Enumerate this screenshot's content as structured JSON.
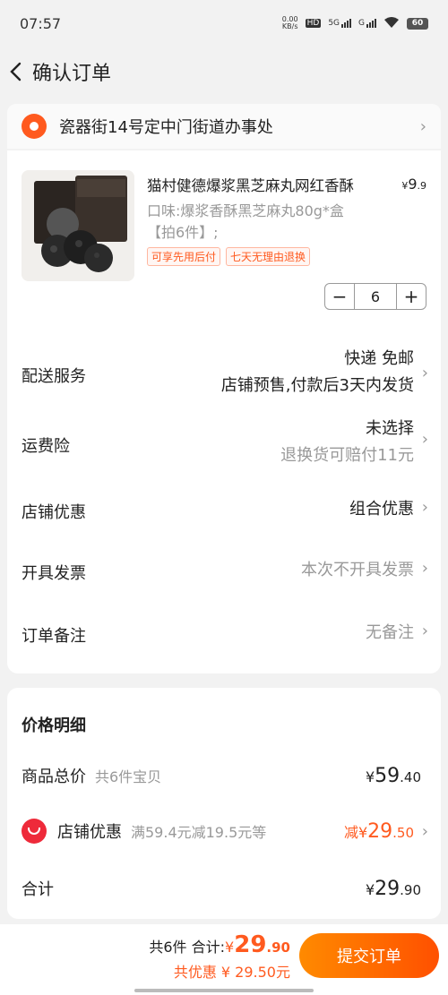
{
  "status_bar": {
    "time": "07:57",
    "net_speed": "0.00",
    "net_unit": "KB/s",
    "hd": "HD",
    "sig1": "5G",
    "sig2": "G",
    "battery": "60"
  },
  "nav": {
    "title": "确认订单"
  },
  "address": {
    "text": "瓷器街14号定中门街道办事处"
  },
  "product": {
    "title": "猫村健德爆浆黑芝麻丸网红香酥",
    "price_symbol": "¥",
    "price_int": "9",
    "price_dec": ".9",
    "spec": "口味:爆浆香酥黑芝麻丸80g*盒【拍6件】;",
    "tags": [
      "可享先用后付",
      "七天无理由退换"
    ],
    "quantity": "6"
  },
  "rows": {
    "delivery": {
      "label": "配送服务",
      "line1": "快递 免邮",
      "line2": "店铺预售,付款后3天内发货"
    },
    "insurance": {
      "label": "运费险",
      "line1": "未选择",
      "line2": "退换货可赔付11元"
    },
    "shop_discount": {
      "label": "店铺优惠",
      "value": "组合优惠"
    },
    "invoice": {
      "label": "开具发票",
      "value": "本次不开具发票"
    },
    "remark": {
      "label": "订单备注",
      "value": "无备注"
    }
  },
  "price_detail": {
    "title": "价格明细",
    "goods_total_label": "商品总价",
    "goods_count": "共6件宝贝",
    "goods_total_cur": "¥",
    "goods_total_int": "59",
    "goods_total_dec": ".40",
    "shop_discount_label": "店铺优惠",
    "shop_discount_note": "满59.4元减19.5元等",
    "shop_discount_prefix": "减",
    "shop_discount_cur": "¥",
    "shop_discount_int": "29",
    "shop_discount_dec": ".50",
    "total_label": "合计",
    "total_cur": "¥",
    "total_int": "29",
    "total_dec": ".90"
  },
  "bottom_bar": {
    "count": "共6件",
    "total_label": "合计:",
    "total_cur": "¥",
    "total_int": "29",
    "total_dec": ".90",
    "saved": "共优惠 ¥ 29.50元",
    "submit_label": "提交订单"
  },
  "colors": {
    "accent": "#ff5a1f",
    "shop_icon": "#ee2a3a",
    "background": "#f2f2f2"
  }
}
